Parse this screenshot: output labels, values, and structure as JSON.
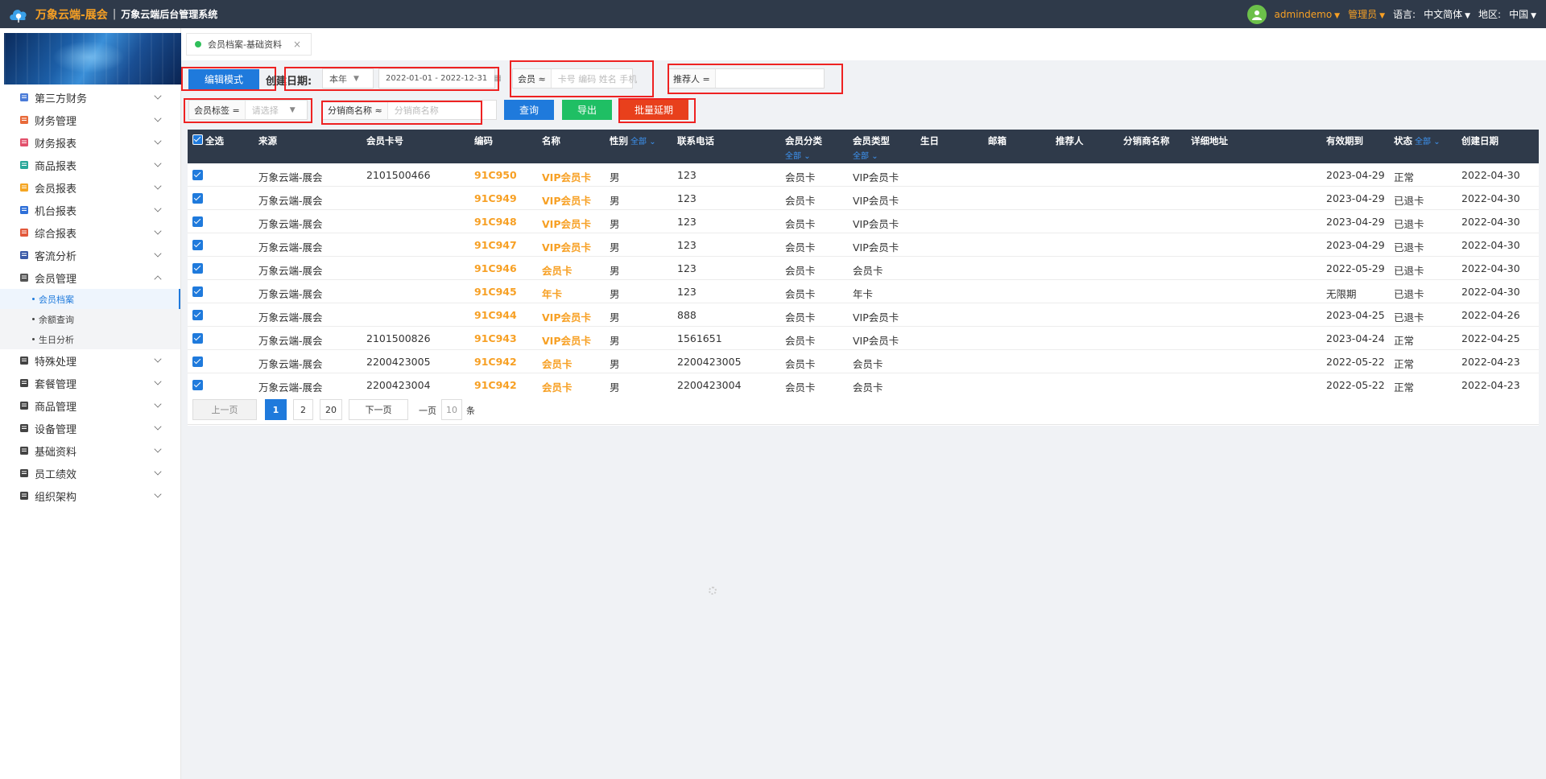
{
  "topbar": {
    "brand": "万象云端-展会",
    "separator": "|",
    "subtitle": "万象云端后台管理系统",
    "user": "admindemo",
    "role": "管理员",
    "language_label": "语言:",
    "language_value": "中文简体",
    "region_label": "地区:",
    "region_value": "中国"
  },
  "sidebar": {
    "items": [
      {
        "label": "第三方财务",
        "icon": "ledger-icon",
        "color": "#4a7bd8"
      },
      {
        "label": "财务管理",
        "icon": "finance-icon",
        "color": "#e86a3a"
      },
      {
        "label": "财务报表",
        "icon": "report-icon",
        "color": "#e2506b"
      },
      {
        "label": "商品报表",
        "icon": "goods-report-icon",
        "color": "#2aa89a"
      },
      {
        "label": "会员报表",
        "icon": "member-report-icon",
        "color": "#f5a623"
      },
      {
        "label": "机台报表",
        "icon": "machine-report-icon",
        "color": "#2e6fd8"
      },
      {
        "label": "综合报表",
        "icon": "layers-icon",
        "color": "#e2583a"
      },
      {
        "label": "客流分析",
        "icon": "traffic-icon",
        "color": "#3b5ba8"
      },
      {
        "label": "会员管理",
        "icon": "user-icon",
        "color": "#555"
      }
    ],
    "subitems": [
      {
        "label": "会员档案",
        "active": true
      },
      {
        "label": "余额查询",
        "active": false
      },
      {
        "label": "生日分析",
        "active": false
      }
    ],
    "items_after": [
      {
        "label": "特殊处理",
        "icon": "warning-icon",
        "color": "#444"
      },
      {
        "label": "套餐管理",
        "icon": "edit-icon",
        "color": "#444"
      },
      {
        "label": "商品管理",
        "icon": "exchange-icon",
        "color": "#444"
      },
      {
        "label": "设备管理",
        "icon": "device-icon",
        "color": "#444"
      },
      {
        "label": "基础资料",
        "icon": "document-icon",
        "color": "#444"
      },
      {
        "label": "员工绩效",
        "icon": "gear-icon",
        "color": "#444"
      },
      {
        "label": "组织架构",
        "icon": "target-icon",
        "color": "#444"
      }
    ]
  },
  "tab": {
    "label": "会员档案-基础资料",
    "close": "×"
  },
  "toolbar": {
    "edit_mode": "编辑模式",
    "create_date_label": "创建日期:",
    "period": "本年",
    "date_range": "2022-01-01 - 2022-12-31",
    "member_label": "会员 ≈",
    "member_placeholder": "卡号 编码 姓名 手机",
    "referrer_label": "推荐人 =",
    "tag_label": "会员标签 =",
    "tag_placeholder": "请选择",
    "distributor_label": "分销商名称 ≈",
    "distributor_placeholder": "分销商名称",
    "query": "查询",
    "export": "导出",
    "batch_extend": "批量延期"
  },
  "colors": {
    "accent": "#1f7adc",
    "orange": "#f7a024",
    "green": "#1fbf64",
    "red": "#e8401c",
    "header": "#2f3a4a"
  },
  "table": {
    "headers": {
      "select_all": "全选",
      "source": "来源",
      "card_no": "会员卡号",
      "code": "编码",
      "name": "名称",
      "gender": "性别",
      "gender_filter": "全部",
      "phone": "联系电话",
      "category": "会员分类",
      "category_filter": "全部",
      "type": "会员类型",
      "type_filter": "全部",
      "birthday": "生日",
      "email": "邮箱",
      "referrer": "推荐人",
      "distributor": "分销商名称",
      "address": "详细地址",
      "valid_until": "有效期到",
      "status": "状态",
      "status_filter": "全部",
      "created": "创建日期"
    },
    "rows": [
      {
        "source": "万象云端-展会",
        "card_no": "2101500466",
        "code": "91C950",
        "name": "VIP会员卡",
        "gender": "男",
        "phone": "123",
        "category": "会员卡",
        "type": "VIP会员卡",
        "valid_until": "2023-04-29",
        "status": "正常",
        "created": "2022-04-30"
      },
      {
        "source": "万象云端-展会",
        "card_no": "",
        "code": "91C949",
        "name": "VIP会员卡",
        "gender": "男",
        "phone": "123",
        "category": "会员卡",
        "type": "VIP会员卡",
        "valid_until": "2023-04-29",
        "status": "已退卡",
        "created": "2022-04-30"
      },
      {
        "source": "万象云端-展会",
        "card_no": "",
        "code": "91C948",
        "name": "VIP会员卡",
        "gender": "男",
        "phone": "123",
        "category": "会员卡",
        "type": "VIP会员卡",
        "valid_until": "2023-04-29",
        "status": "已退卡",
        "created": "2022-04-30"
      },
      {
        "source": "万象云端-展会",
        "card_no": "",
        "code": "91C947",
        "name": "VIP会员卡",
        "gender": "男",
        "phone": "123",
        "category": "会员卡",
        "type": "VIP会员卡",
        "valid_until": "2023-04-29",
        "status": "已退卡",
        "created": "2022-04-30"
      },
      {
        "source": "万象云端-展会",
        "card_no": "",
        "code": "91C946",
        "name": "会员卡",
        "gender": "男",
        "phone": "123",
        "category": "会员卡",
        "type": "会员卡",
        "valid_until": "2022-05-29",
        "status": "已退卡",
        "created": "2022-04-30"
      },
      {
        "source": "万象云端-展会",
        "card_no": "",
        "code": "91C945",
        "name": "年卡",
        "gender": "男",
        "phone": "123",
        "category": "会员卡",
        "type": "年卡",
        "valid_until": "无限期",
        "status": "已退卡",
        "created": "2022-04-30"
      },
      {
        "source": "万象云端-展会",
        "card_no": "",
        "code": "91C944",
        "name": "VIP会员卡",
        "gender": "男",
        "phone": "888",
        "category": "会员卡",
        "type": "VIP会员卡",
        "valid_until": "2023-04-25",
        "status": "已退卡",
        "created": "2022-04-26"
      },
      {
        "source": "万象云端-展会",
        "card_no": "2101500826",
        "code": "91C943",
        "name": "VIP会员卡",
        "gender": "男",
        "phone": "1561651",
        "category": "会员卡",
        "type": "VIP会员卡",
        "valid_until": "2023-04-24",
        "status": "正常",
        "created": "2022-04-25"
      },
      {
        "source": "万象云端-展会",
        "card_no": "2200423005",
        "code": "91C942",
        "name": "会员卡",
        "gender": "男",
        "phone": "2200423005",
        "category": "会员卡",
        "type": "会员卡",
        "valid_until": "2022-05-22",
        "status": "正常",
        "created": "2022-04-23"
      },
      {
        "source": "万象云端-展会",
        "card_no": "2200423004",
        "code": "91C942",
        "name": "会员卡",
        "gender": "男",
        "phone": "2200423004",
        "category": "会员卡",
        "type": "会员卡",
        "valid_until": "2022-05-22",
        "status": "正常",
        "created": "2022-04-23"
      }
    ]
  },
  "pager": {
    "prev": "上一页",
    "pages": [
      "1",
      "2",
      "20"
    ],
    "current": "1",
    "next": "下一页",
    "per_page_label": "一页",
    "per_page_value": "10",
    "unit": "条"
  }
}
